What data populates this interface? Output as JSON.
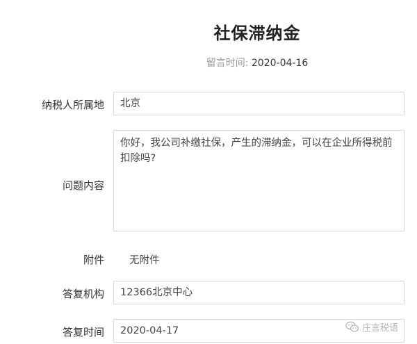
{
  "page": {
    "title": "社保滞纳金",
    "message_time_label": "留言时间:",
    "message_time_value": "2020-04-16"
  },
  "form": {
    "taxpayer_location": {
      "label": "纳税人所属地",
      "value": "北京"
    },
    "question": {
      "label": "问题内容",
      "value": "你好，我公司补缴社保，产生的滞纳金，可以在企业所得税前扣除吗?"
    },
    "attachment": {
      "label": "附件",
      "value": "无附件"
    },
    "reply_org": {
      "label": "答复机构",
      "value": "12366北京中心"
    },
    "reply_time": {
      "label": "答复时间",
      "value": "2020-04-17"
    }
  },
  "watermark": {
    "icon": "wechat-icon",
    "text": "庄言税语"
  }
}
